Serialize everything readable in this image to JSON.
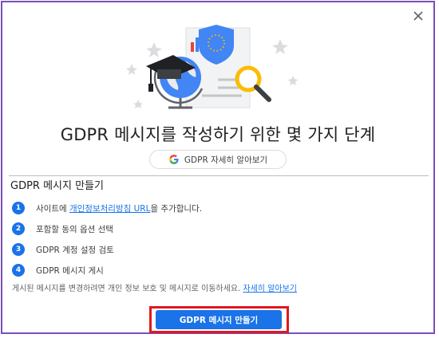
{
  "dialog": {
    "title": "GDPR 메시지를 작성하기 위한 몇 가지 단계",
    "learn_more_chip": "GDPR 자세히 알아보기",
    "section_title": "GDPR 메시지 만들기",
    "steps": [
      {
        "num": "1",
        "prefix": "사이트에 ",
        "link": "개인정보처리방침 URL",
        "suffix": "을 추가합니다."
      },
      {
        "num": "2",
        "text": "포함할 동의 옵션 선택"
      },
      {
        "num": "3",
        "text": "GDPR 계정 설정 검토"
      },
      {
        "num": "4",
        "text": "GDPR 메시지 게시"
      }
    ],
    "note_text": "게시된 메시지를 변경하려면 개인 정보 보호 및 메시지로 이동하세요. ",
    "note_link": "자세히 알아보기",
    "primary_button": "GDPR 메시지 만들기",
    "close_symbol": "×"
  },
  "colors": {
    "frame_border": "#7a4fb8",
    "primary": "#1a73e8",
    "highlight": "#e0181f",
    "text": "#202124"
  },
  "icons": [
    "close-icon",
    "google-g-icon",
    "shield-eu-icon",
    "globe-icon",
    "graduation-cap-icon",
    "magnifier-icon",
    "bar-chart-icon"
  ]
}
